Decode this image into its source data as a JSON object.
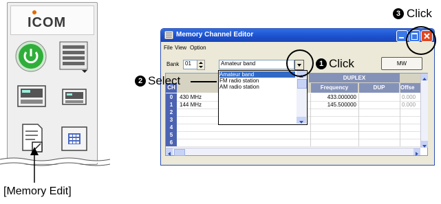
{
  "launcher": {
    "logo": "ICOM",
    "caption": "[Memory Edit]"
  },
  "editor": {
    "title": "Memory Channel Editor",
    "menu": [
      "File",
      "View",
      "Option"
    ],
    "bank_label": "Bank",
    "bank_value": "01",
    "list_value": "Amateur band",
    "list_options": [
      "Amateur band",
      "FM radio station",
      "AM radio station"
    ],
    "mw_button": "MW",
    "columns": {
      "ch": "CH",
      "frequency": "Frequency",
      "duplex": "DUPLEX",
      "dup": "DUP",
      "offset": "Offse"
    },
    "rows": [
      {
        "ch": "0",
        "name": "430 MHz",
        "freq": "433.000000",
        "offset": "0.000"
      },
      {
        "ch": "1",
        "name": "144 MHz",
        "freq": "145.500000",
        "offset": "0.000"
      },
      {
        "ch": "2",
        "name": "",
        "freq": "",
        "offset": ""
      },
      {
        "ch": "3",
        "name": "",
        "freq": "",
        "offset": ""
      },
      {
        "ch": "4",
        "name": "",
        "freq": "",
        "offset": ""
      },
      {
        "ch": "5",
        "name": "",
        "freq": "",
        "offset": ""
      },
      {
        "ch": "6",
        "name": "",
        "freq": "",
        "offset": ""
      }
    ]
  },
  "callouts": {
    "step1_num": "1",
    "step1_text": "Click",
    "step2_num": "2",
    "step2_text": "Select",
    "step3_num": "3",
    "step3_text": "Click"
  },
  "colors": {
    "titlebar": "#1c4fcb",
    "close_button": "#e0461f",
    "selection": "#316ac5",
    "grid_row_header": "#4b63b2",
    "power_green": "#2fae3a"
  }
}
